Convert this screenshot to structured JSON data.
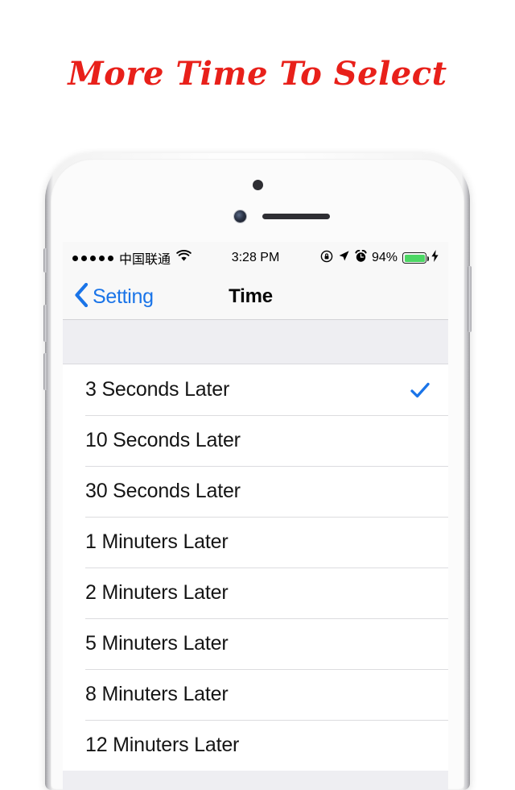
{
  "headline": "More Time To Select",
  "colors": {
    "headline_red": "#e8201a",
    "ios_blue": "#1a74e8",
    "battery_green": "#4cd764",
    "table_gray": "#eeeef2"
  },
  "phone": {
    "hardware": {
      "sensor": "proximity-sensor",
      "camera": "front-camera",
      "speaker": "earpiece-speaker",
      "buttons": [
        "mute-switch",
        "volume-up",
        "volume-down",
        "power"
      ]
    }
  },
  "status_bar": {
    "signal_dots": 5,
    "carrier": "中国联通",
    "wifi": "wifi-icon",
    "time": "3:28 PM",
    "rotation_lock": "rotation-lock-icon",
    "location": "location-arrow-icon",
    "alarm": "alarm-clock-icon",
    "battery_percent": "94%",
    "battery_level": 94,
    "charging": "charging-bolt-icon"
  },
  "nav_bar": {
    "back_label": "Setting",
    "back_icon": "chevron-left-icon",
    "title": "Time"
  },
  "list": {
    "selected_index": 0,
    "check_icon": "checkmark-icon",
    "items": [
      {
        "label": "3 Seconds Later",
        "selected": true
      },
      {
        "label": "10 Seconds Later",
        "selected": false
      },
      {
        "label": "30 Seconds Later",
        "selected": false
      },
      {
        "label": "1 Minuters Later",
        "selected": false
      },
      {
        "label": "2 Minuters Later",
        "selected": false
      },
      {
        "label": "5 Minuters Later",
        "selected": false
      },
      {
        "label": "8 Minuters Later",
        "selected": false
      },
      {
        "label": "12 Minuters Later",
        "selected": false
      }
    ]
  }
}
